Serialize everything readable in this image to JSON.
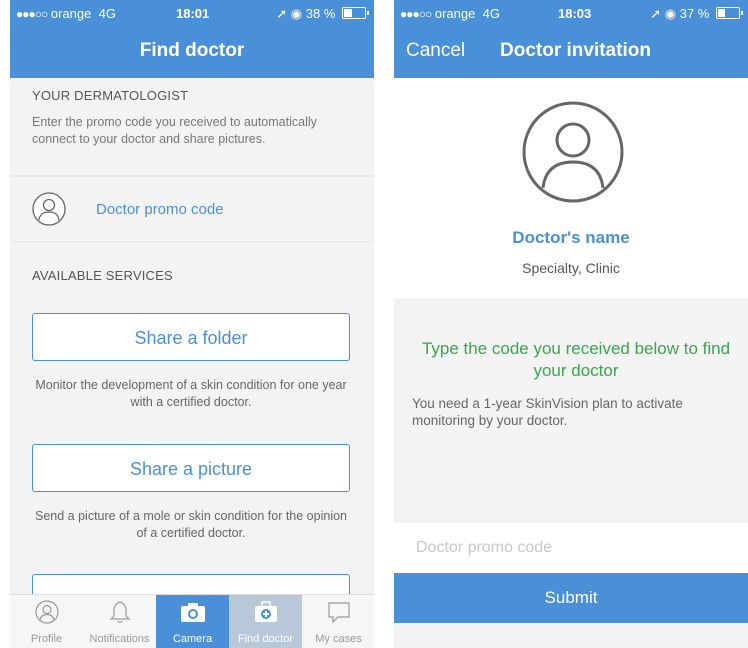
{
  "left": {
    "status": {
      "dots": "●●●○○",
      "carrier": "orange",
      "network": "4G",
      "time": "18:01",
      "battery": "38 %",
      "battery_level": 0.38
    },
    "nav_title": "Find doctor",
    "dermatologist": {
      "header": "YOUR DERMATOLOGIST",
      "description": "Enter the promo code you received to automatically connect to your doctor and share pictures."
    },
    "promo_link": "Doctor promo code",
    "services": {
      "header": "AVAILABLE SERVICES",
      "items": [
        {
          "label": "Share a folder",
          "description": "Monitor the development of a skin condition for one year with a certified doctor."
        },
        {
          "label": "Share a picture",
          "description": "Send a picture of a mole or skin condition for the opinion of a certified doctor."
        }
      ]
    },
    "tabs": [
      {
        "label": "Profile",
        "icon": "profile-icon"
      },
      {
        "label": "Notifications",
        "icon": "bell-icon"
      },
      {
        "label": "Camera",
        "icon": "camera-icon"
      },
      {
        "label": "Find doctor",
        "icon": "medkit-icon"
      },
      {
        "label": "My cases",
        "icon": "chat-icon"
      }
    ]
  },
  "right": {
    "status": {
      "dots": "●●●○○",
      "carrier": "orange",
      "network": "4G",
      "time": "18:03",
      "battery": "37 %",
      "battery_level": 0.37
    },
    "cancel_label": "Cancel",
    "nav_title": "Doctor invitation",
    "doctor_name": "Doctor's name",
    "specialty": "Specialty, Clinic",
    "instruction": "Type the code you received below to find your doctor",
    "plan_note": "You need a 1-year SkinVision plan to activate monitoring by your doctor.",
    "promo_input": {
      "placeholder": "Doctor promo code",
      "value": ""
    },
    "submit_label": "Submit"
  },
  "colors": {
    "accent": "#4a90d9",
    "green": "#3aa64a",
    "background": "#f3f3f3"
  }
}
